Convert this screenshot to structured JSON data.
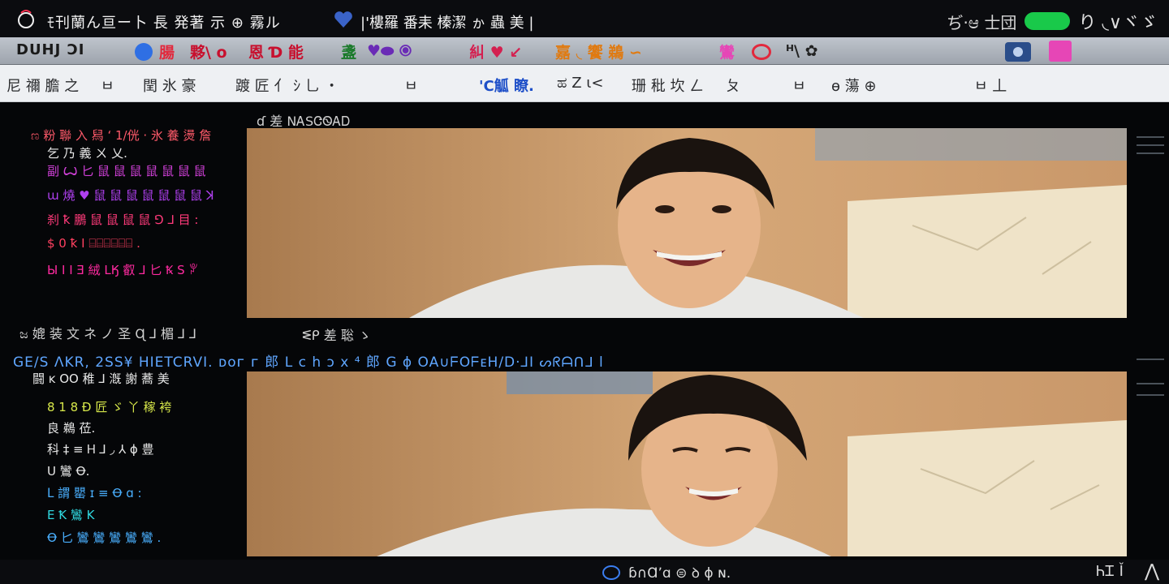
{
  "titlebar": {
    "title": "ﾓ刊蘭ん亘ー卜 長 発著 示 ⊕ 霧ル",
    "subtitle": "|'樓羅 番耒 榛潔 ゕ 蟲 美 |",
    "right_text": "ぢ·ಆ 士団",
    "controls": "り ◟∨ヾゞ",
    "pill_color": "#19c94a"
  },
  "toolbar": {
    "first": "DUHJ ƆI",
    "items": [
      {
        "label": "腸",
        "color": "#e2283c"
      },
      {
        "label": "夥\\ o",
        "color": "#c8102e"
      },
      {
        "label": "恩 Ɗ 能",
        "color": "#c8102e"
      },
      {
        "label": "盞",
        "color": "#1a7a2a"
      },
      {
        "label": "♥⬬ ⦿",
        "color": "#6a2bb6"
      },
      {
        "label": "糾 ♥ ↙",
        "color": "#d42050"
      },
      {
        "label": "嘉 ◟ 饗 鵜 ∽",
        "color": "#e07a10"
      },
      {
        "label": "鸞",
        "color": "#e646b6"
      },
      {
        "label": "ᴴ\\ ✿",
        "color": "#222222"
      }
    ]
  },
  "menubar": {
    "items": [
      "尼 禰 膽 之",
      "ㅂ",
      "閏 氷 豪",
      "踱 匠 亻 ｼ 乚 ・",
      "ㅂ",
      "'C觚 瞭.",
      "ಹ Z ι<",
      "珊 秕 坎 ㄥ",
      "ㄆ",
      "ㅂ",
      "ɵ 蕩 ⊕",
      "ㅂ 丄"
    ]
  },
  "side": {
    "section1_lines": [
      {
        "text": "ಣ 粉 聯 入 舄 ‘ 1/侊 · 氷 養 燙 詹",
        "color": "#ff5a6a"
      },
      {
        "text": "乞 乃 義 ㄨ 乂.",
        "color": "#e8e8e8"
      },
      {
        "text": "副 Ꙍ 匕 鼠 鼠 鼠 鼠 鼠 鼠 鼠",
        "color": "#d040d8"
      },
      {
        "text": "ɯ 燒 ♥ 鼠 鼠 鼠 鼠 鼠 鼠 鼠 ꓘ",
        "color": "#b040f0"
      },
      {
        "text": "刹 ꝁ 鵬 鼠 鼠 鼠 鼠 ⅁ ⅃ 目 :",
        "color": "#ff3a7a"
      },
      {
        "text": "$ 0 ꝁ Ⅰ ⌸⌸⌸⌸⌸⌸ .",
        "color": "#ff4060"
      },
      {
        "text": "Ы I I Ǝ 絨 LӃ 叡 ⅃ 匕 Ꝅ Ѕ ꐕ",
        "color": "#ff2aa0"
      }
    ],
    "section2_head": "ಜ 媲 装 文 ネ ノ 圣 Ɋ ⅃ 楣 ⅃ ⅃",
    "section3_head": "闘 ĸ OO 稚 ⅃ 漑 謝 蕎 美",
    "section3_lines": [
      {
        "text": "8 1 8 Ɖ 匠 ゞ 丫 稼 袴",
        "color": "#d8e84a"
      },
      {
        "text": "良 鵜 莅.",
        "color": "#e8e8e8"
      },
      {
        "text": "科 ‡ ≡ Ꮋ ⅃ ◞ ⅄ ϕ 豊",
        "color": "#e8e8e8"
      },
      {
        "text": "U 鸞 Ꝋ.",
        "color": "#e8e8e8"
      },
      {
        "text": "ᒪ 謂 罌 ɪ ≡ Ꝋ ɑ :",
        "color": "#4ab0ff"
      },
      {
        "text": "E Ꝁ 鸞 K",
        "color": "#30d8e0"
      },
      {
        "text": "Ꝋ 匕 鸞 鸞 鸞 鸞 鸞 .",
        "color": "#4ab0ff"
      }
    ]
  },
  "videos": [
    {
      "label": "ɗ 差 NᎪSᏣᏫᎪᎠ"
    },
    {
      "label": "ᓬᑭ 差 聡 ゝ"
    }
  ],
  "status_line": "GE/S ΛKR, 2SS¥ HIETCRVI.  ᴅᴏᴦ ᴦ 郎 L ᴄ h ɔ x ⁴ 郎 G  ɸ OA∪ᖴOᖴᴇH/D·⅃Ⅰ  ᔕᖇᗩᑎᒧ l",
  "statusbar": {
    "center_text": "ɓ∩Ɑʼɑ  ⊜ ꝺ ɸ ɴ.",
    "right_text": "ᏂᏆ Ǐ",
    "caret": "⋀"
  }
}
